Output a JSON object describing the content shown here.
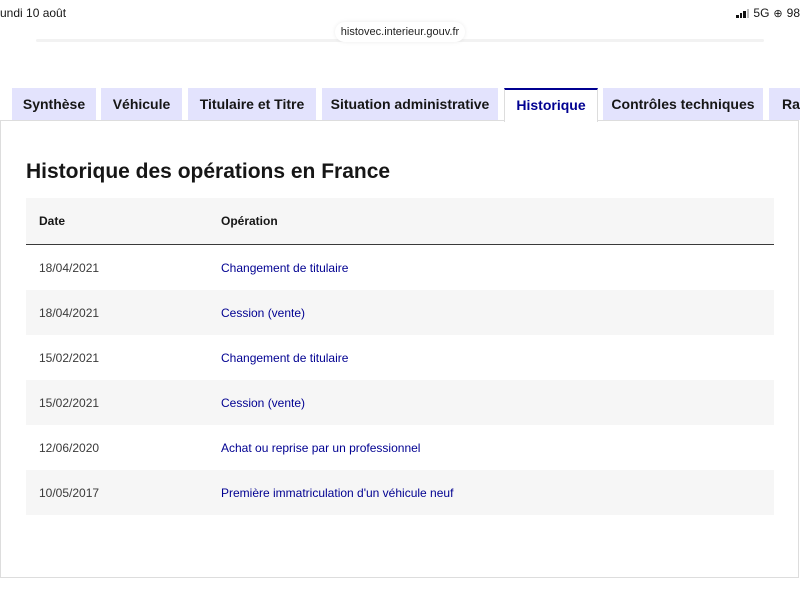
{
  "status_bar": {
    "time": "undi 10 août",
    "network": "5G",
    "battery": "98"
  },
  "browser": {
    "url": "histovec.interieur.gouv.fr"
  },
  "tabs": [
    {
      "label": "Synthèse",
      "active": false
    },
    {
      "label": "Véhicule",
      "active": false
    },
    {
      "label": "Titulaire et Titre",
      "active": false
    },
    {
      "label": "Situation administrative",
      "active": false
    },
    {
      "label": "Historique",
      "active": true
    },
    {
      "label": "Contrôles techniques",
      "active": false
    },
    {
      "label": "Rap",
      "active": false
    }
  ],
  "main": {
    "title": "Historique des opérations en France",
    "table": {
      "columns": [
        "Date",
        "Opération"
      ],
      "rows": [
        {
          "date": "18/04/2021",
          "operation": "Changement de titulaire"
        },
        {
          "date": "18/04/2021",
          "operation": "Cession (vente)"
        },
        {
          "date": "15/02/2021",
          "operation": "Changement de titulaire"
        },
        {
          "date": "15/02/2021",
          "operation": "Cession (vente)"
        },
        {
          "date": "12/06/2020",
          "operation": "Achat ou reprise par un professionnel"
        },
        {
          "date": "10/05/2017",
          "operation": "Première immatriculation d'un véhicule neuf"
        }
      ]
    }
  },
  "colors": {
    "accent": "#000091",
    "tab_bg": "#e3e3fd",
    "row_alt": "#f6f6f6"
  }
}
